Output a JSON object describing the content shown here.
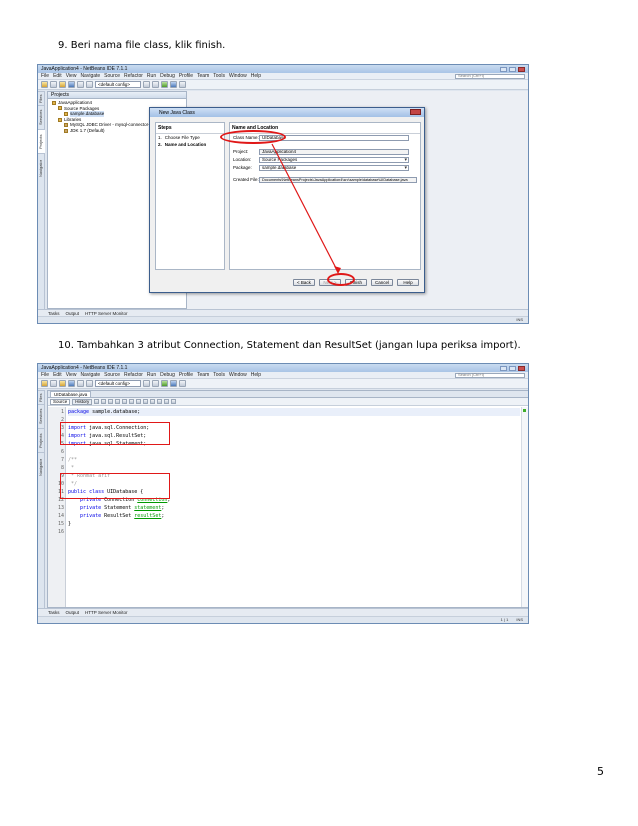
{
  "step9": {
    "text": "9.   Beri nama file class, klik finish."
  },
  "step10": {
    "text": "10.  Tambahkan 3 atribut Connection, Statement dan ResultSet (jangan lupa periksa import)."
  },
  "page_number": "5",
  "ide": {
    "title": "JavaApplication4 - NetBeans IDE 7.1.1",
    "menu": [
      "File",
      "Edit",
      "View",
      "Navigate",
      "Source",
      "Refactor",
      "Run",
      "Debug",
      "Profile",
      "Team",
      "Tools",
      "Window",
      "Help"
    ],
    "search_placeholder": "Search (Ctrl+I)",
    "config_combo": "<default config>",
    "side_tabs": [
      "Files",
      "Services",
      "Projects",
      "Navigator"
    ],
    "status_tabs": [
      "Tasks",
      "Output",
      "HTTP Server Monitor"
    ],
    "status_right1": "INS",
    "status_right2_pos": "1 | 1",
    "status_right2_ins": "INS"
  },
  "projects_panel": {
    "title": "Projects",
    "tree": [
      {
        "label": "JavaApplication4",
        "level": 0
      },
      {
        "label": "Source Packages",
        "level": 1
      },
      {
        "label": "sample.database",
        "level": 2
      },
      {
        "label": "Libraries",
        "level": 1
      },
      {
        "label": "MySQL JDBC Driver - mysql-connector-java",
        "level": 2
      },
      {
        "label": "JDK 1.7 (Default)",
        "level": 2
      }
    ]
  },
  "dialog": {
    "title": "New Java Class",
    "steps_title": "Steps",
    "steps": [
      {
        "num": "1.",
        "label": "Choose File Type"
      },
      {
        "num": "2.",
        "label": "Name and Location"
      }
    ],
    "section_title": "Name and Location",
    "class_name_label": "Class Name:",
    "class_name_value": "UIDatabase",
    "project_label": "Project:",
    "project_value": "JavaApplication4",
    "location_label": "Location:",
    "location_value": "Source Packages",
    "package_label": "Package:",
    "package_value": "sample.database",
    "created_label": "Created File:",
    "created_value": "Documents\\NetBeansProjects\\JavaApplication4\\src\\sample\\database\\UIDatabase.java",
    "buttons": {
      "back": "< Back",
      "next": "Next >",
      "finish": "Finish",
      "cancel": "Cancel",
      "help": "Help"
    }
  },
  "editor": {
    "file_tab": "UIDatabase.java",
    "source_tab": "Source",
    "history_tab": "History",
    "lines": [
      {
        "n": "1",
        "code": "package sample.database;",
        "type": "pkg"
      },
      {
        "n": "2",
        "code": "",
        "type": "plain"
      },
      {
        "n": "3",
        "code": "import java.sql.Connection;",
        "type": "imp"
      },
      {
        "n": "4",
        "code": "import java.sql.ResultSet;",
        "type": "imp"
      },
      {
        "n": "5",
        "code": "import java.sql.Statement;",
        "type": "imp"
      },
      {
        "n": "6",
        "code": "",
        "type": "plain"
      },
      {
        "n": "7",
        "code": "/**",
        "type": "cm"
      },
      {
        "n": "8",
        "code": " *",
        "type": "cm"
      },
      {
        "n": "9",
        "code": " * Rohmat arif",
        "type": "cm"
      },
      {
        "n": "10",
        "code": " */",
        "type": "cm"
      },
      {
        "n": "11",
        "code": "public class UIDatabase {",
        "type": "cls"
      },
      {
        "n": "12",
        "code": "    private Connection connection;",
        "type": "fld"
      },
      {
        "n": "13",
        "code": "    private Statement statement;",
        "type": "fld"
      },
      {
        "n": "14",
        "code": "    private ResultSet resultSet;",
        "type": "fld"
      },
      {
        "n": "15",
        "code": "}",
        "type": "plain"
      },
      {
        "n": "16",
        "code": "",
        "type": "plain"
      }
    ]
  }
}
